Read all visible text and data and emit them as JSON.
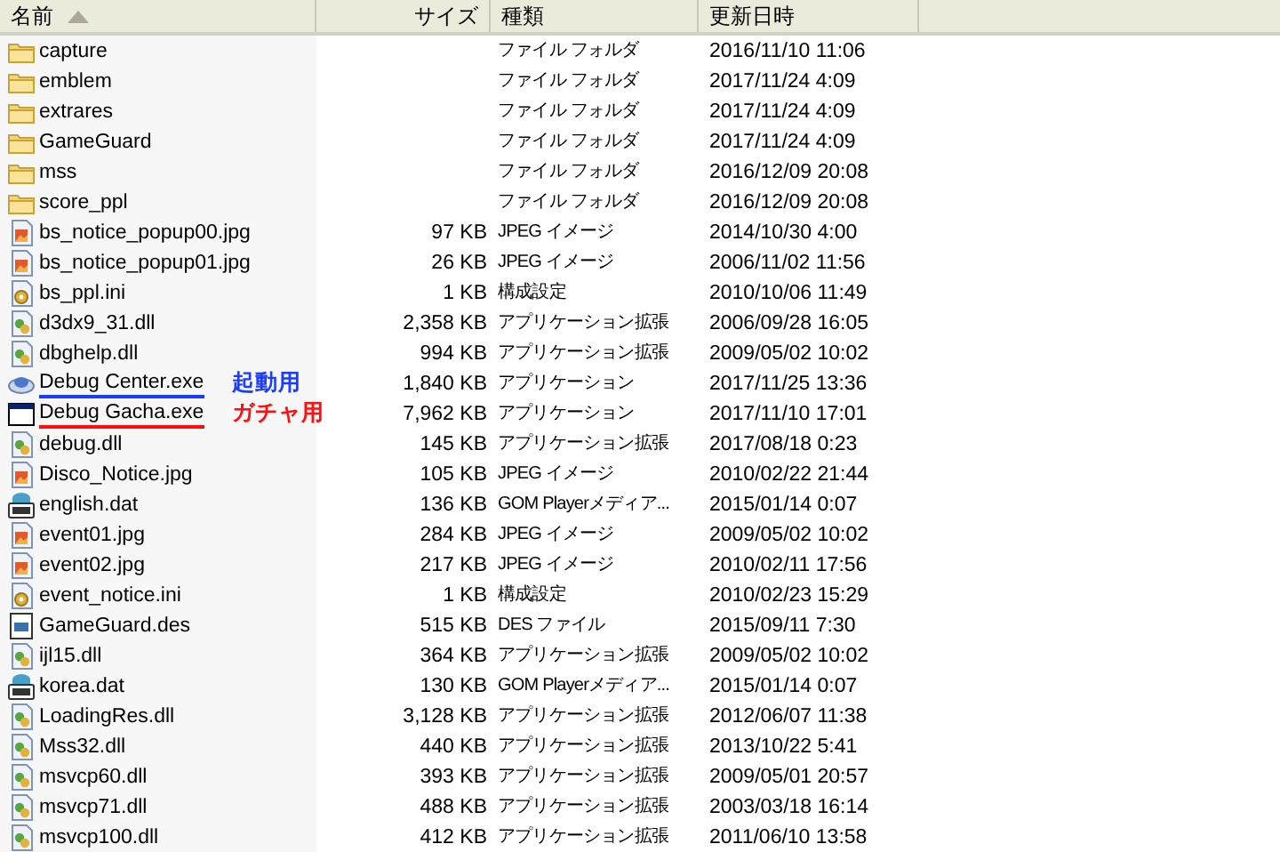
{
  "columns": [
    {
      "label": "名前",
      "sorted": true
    },
    {
      "label": "サイズ",
      "sorted": false
    },
    {
      "label": "種類",
      "sorted": false
    },
    {
      "label": "更新日時",
      "sorted": false
    }
  ],
  "rows": [
    {
      "kind": "folder",
      "name": "capture",
      "size": "",
      "type": "ファイル フォルダ",
      "modified": "2016/11/10 11:06"
    },
    {
      "kind": "folder",
      "name": "emblem",
      "size": "",
      "type": "ファイル フォルダ",
      "modified": "2017/11/24 4:09"
    },
    {
      "kind": "folder",
      "name": "extrares",
      "size": "",
      "type": "ファイル フォルダ",
      "modified": "2017/11/24 4:09"
    },
    {
      "kind": "folder",
      "name": "GameGuard",
      "size": "",
      "type": "ファイル フォルダ",
      "modified": "2017/11/24 4:09"
    },
    {
      "kind": "folder",
      "name": "mss",
      "size": "",
      "type": "ファイル フォルダ",
      "modified": "2016/12/09 20:08"
    },
    {
      "kind": "folder",
      "name": "score_ppl",
      "size": "",
      "type": "ファイル フォルダ",
      "modified": "2016/12/09 20:08"
    },
    {
      "kind": "jpeg",
      "name": "bs_notice_popup00.jpg",
      "size": "97 KB",
      "type": "JPEG イメージ",
      "modified": "2014/10/30 4:00"
    },
    {
      "kind": "jpeg",
      "name": "bs_notice_popup01.jpg",
      "size": "26 KB",
      "type": "JPEG イメージ",
      "modified": "2006/11/02 11:56"
    },
    {
      "kind": "settings",
      "name": "bs_ppl.ini",
      "size": "1 KB",
      "type": "構成設定",
      "modified": "2010/10/06 11:49"
    },
    {
      "kind": "dll",
      "name": "d3dx9_31.dll",
      "size": "2,358 KB",
      "type": "アプリケーション拡張",
      "modified": "2006/09/28 16:05"
    },
    {
      "kind": "dll",
      "name": "dbghelp.dll",
      "size": "994 KB",
      "type": "アプリケーション拡張",
      "modified": "2009/05/02 10:02"
    },
    {
      "kind": "app",
      "name": "Debug Center.exe",
      "size": "1,840 KB",
      "type": "アプリケーション",
      "modified": "2017/11/25 13:36",
      "annotation": {
        "text": "起動用",
        "color": "#1a3cff"
      }
    },
    {
      "kind": "window",
      "name": "Debug Gacha.exe",
      "size": "7,962 KB",
      "type": "アプリケーション",
      "modified": "2017/11/10 17:01",
      "annotation": {
        "text": "ガチャ用",
        "color": "#ff1010"
      }
    },
    {
      "kind": "dll",
      "name": "debug.dll",
      "size": "145 KB",
      "type": "アプリケーション拡張",
      "modified": "2017/08/18 0:23"
    },
    {
      "kind": "jpeg",
      "name": "Disco_Notice.jpg",
      "size": "105 KB",
      "type": "JPEG イメージ",
      "modified": "2010/02/22 21:44"
    },
    {
      "kind": "dat",
      "name": "english.dat",
      "size": "136 KB",
      "type": "GOM Playerメディア...",
      "modified": "2015/01/14 0:07"
    },
    {
      "kind": "jpeg",
      "name": "event01.jpg",
      "size": "284 KB",
      "type": "JPEG イメージ",
      "modified": "2009/05/02 10:02"
    },
    {
      "kind": "jpeg",
      "name": "event02.jpg",
      "size": "217 KB",
      "type": "JPEG イメージ",
      "modified": "2010/02/11 17:56"
    },
    {
      "kind": "settings",
      "name": "event_notice.ini",
      "size": "1 KB",
      "type": "構成設定",
      "modified": "2010/02/23 15:29"
    },
    {
      "kind": "des",
      "name": "GameGuard.des",
      "size": "515 KB",
      "type": "DES ファイル",
      "modified": "2015/09/11 7:30"
    },
    {
      "kind": "dll",
      "name": "ijl15.dll",
      "size": "364 KB",
      "type": "アプリケーション拡張",
      "modified": "2009/05/02 10:02"
    },
    {
      "kind": "dat",
      "name": "korea.dat",
      "size": "130 KB",
      "type": "GOM Playerメディア...",
      "modified": "2015/01/14 0:07"
    },
    {
      "kind": "dll",
      "name": "LoadingRes.dll",
      "size": "3,128 KB",
      "type": "アプリケーション拡張",
      "modified": "2012/06/07 11:38"
    },
    {
      "kind": "dll",
      "name": "Mss32.dll",
      "size": "440 KB",
      "type": "アプリケーション拡張",
      "modified": "2013/10/22 5:41"
    },
    {
      "kind": "dll",
      "name": "msvcp60.dll",
      "size": "393 KB",
      "type": "アプリケーション拡張",
      "modified": "2009/05/01 20:57"
    },
    {
      "kind": "dll",
      "name": "msvcp71.dll",
      "size": "488 KB",
      "type": "アプリケーション拡張",
      "modified": "2003/03/18 16:14"
    },
    {
      "kind": "dll",
      "name": "msvcp100.dll",
      "size": "412 KB",
      "type": "アプリケーション拡張",
      "modified": "2011/06/10 13:58"
    }
  ]
}
